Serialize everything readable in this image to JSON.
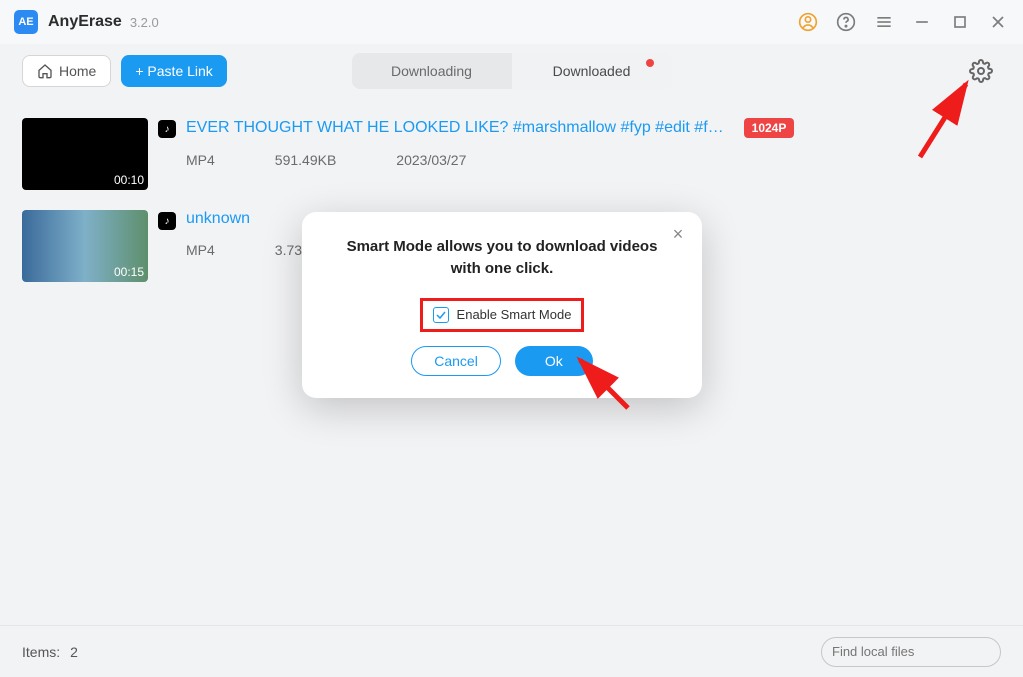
{
  "titlebar": {
    "app_name": "AnyErase",
    "version": "3.2.0"
  },
  "toolbar": {
    "home_label": "Home",
    "paste_label": "+ Paste Link",
    "seg_downloading": "Downloading",
    "seg_downloaded": "Downloaded"
  },
  "items": [
    {
      "duration": "00:10",
      "source_icon": "tiktok-icon",
      "title": "EVER THOUGHT WHAT HE LOOKED LIKE? #marshmallow #fyp #edit #f…",
      "badge": "1024P",
      "format": "MP4",
      "size": "591.49KB",
      "date": "2023/03/27"
    },
    {
      "duration": "00:15",
      "source_icon": "tiktok-icon",
      "title": "unknown",
      "badge": "",
      "format": "MP4",
      "size": "3.73",
      "date": ""
    }
  ],
  "statusbar": {
    "items_label": "Items:",
    "items_count": "2",
    "search_placeholder": "Find local files"
  },
  "modal": {
    "message": "Smart Mode allows you to download videos with one click.",
    "checkbox_label": "Enable Smart Mode",
    "cancel_label": "Cancel",
    "ok_label": "Ok"
  }
}
